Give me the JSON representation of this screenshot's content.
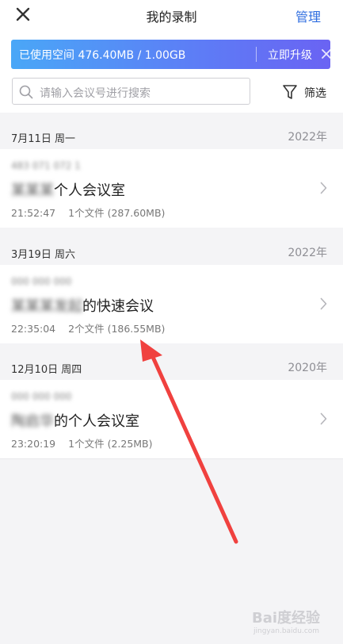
{
  "header": {
    "title": "我的录制",
    "manage_label": "管理"
  },
  "storage": {
    "text": "已使用空间 476.40MB / 1.00GB",
    "upgrade_label": "立即升级"
  },
  "search": {
    "placeholder": "请输入会议号进行搜索"
  },
  "filter": {
    "label": "筛选"
  },
  "groups": [
    {
      "date": "7月11日 周一",
      "year": "2022年",
      "items": [
        {
          "id": "483 071 072 1",
          "name_blur": "某某某",
          "name": "个人会议室",
          "time": "21:52:47",
          "files": "1个文件 (287.60MB)"
        }
      ]
    },
    {
      "date": "3月19日 周六",
      "year": "2022年",
      "items": [
        {
          "id": "000 000 000",
          "name_blur": "某某某发起",
          "name": "的快速会议",
          "time": "22:35:04",
          "files": "2个文件 (186.55MB)"
        }
      ]
    },
    {
      "date": "12月10日 周四",
      "year": "2020年",
      "items": [
        {
          "id": "000 000 000",
          "name_blur": "陶启华",
          "name": "的个人会议室",
          "time": "23:20:19",
          "files": "1个文件 (2.25MB)"
        }
      ]
    }
  ],
  "watermark": {
    "text": "Bai度经验",
    "sub": "jingyan.baidu.com"
  },
  "colors": {
    "accent": "#2f6ee0",
    "arrow": "#f0413f"
  }
}
